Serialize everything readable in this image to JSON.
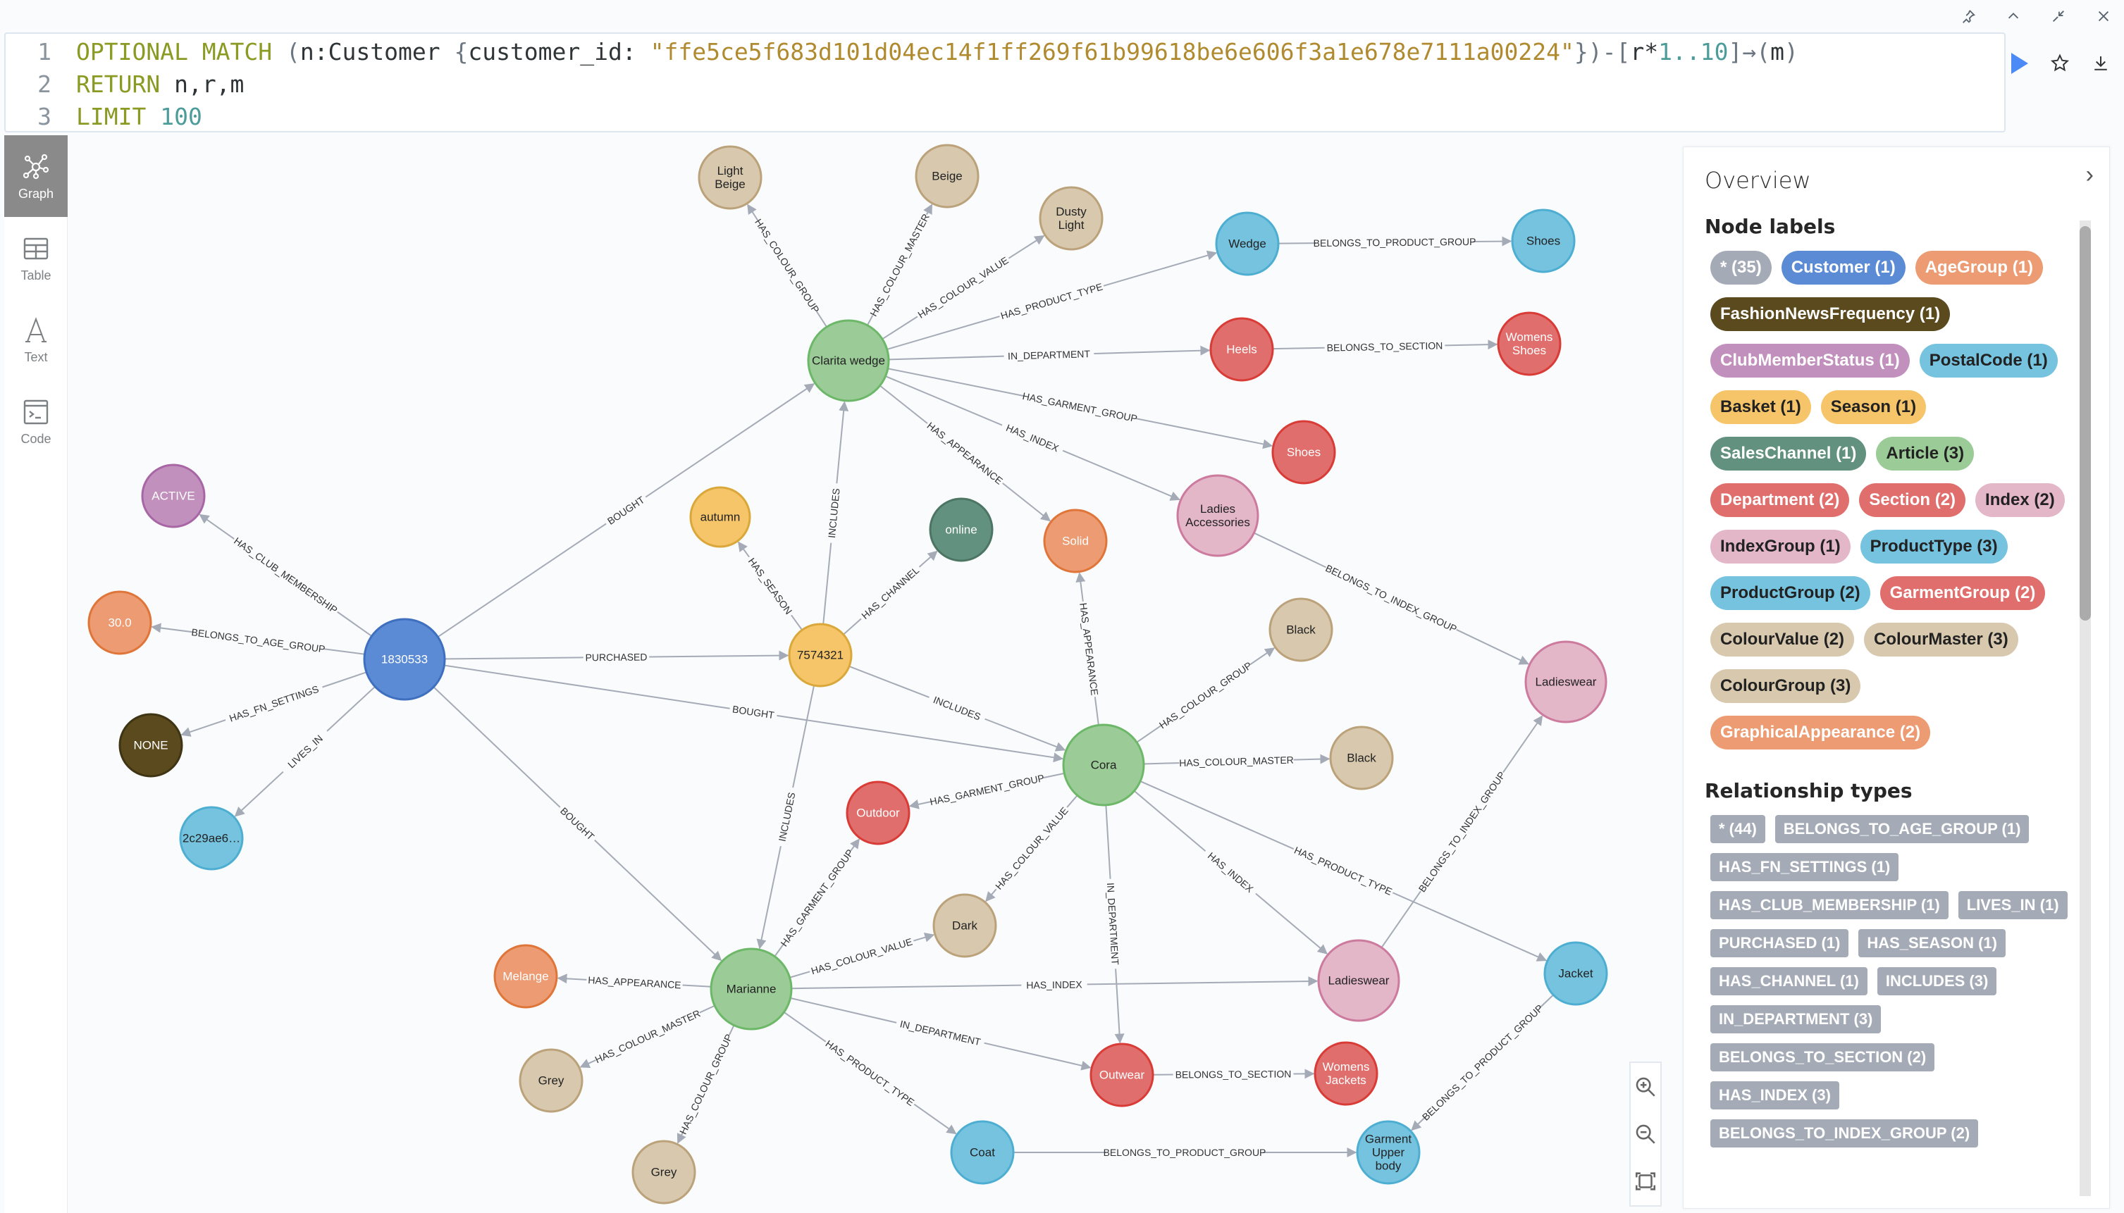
{
  "window_controls": [
    {
      "name": "pin-icon",
      "glyph": "⌖"
    },
    {
      "name": "collapse-up-icon",
      "glyph": "⌃"
    },
    {
      "name": "minimize-icon",
      "glyph": "↙"
    },
    {
      "name": "close-icon",
      "glyph": "✕"
    }
  ],
  "editor": {
    "line_numbers": [
      "1",
      "2",
      "3"
    ],
    "line1": {
      "kw": "OPTIONAL MATCH",
      "open": " (",
      "label": "n:Customer ",
      "brace_open": "{",
      "prop": "customer_id: ",
      "value": "\"ffe5ce5f683d101d04ec14f1ff269f61b99618be6e606f3a1e678e7111a00224\"",
      "brace_close": "})-[",
      "rel": "r*",
      "range": "1..10",
      "arrow": "]→(",
      "target": "m",
      "close": ")"
    },
    "line2": {
      "kw": "RETURN",
      "rest": " n,r,m"
    },
    "line3": {
      "kw": "LIMIT",
      "num": " 100"
    }
  },
  "editor_actions": {
    "run": "run-query",
    "favorite": "favorite",
    "download": "download"
  },
  "nav": [
    {
      "id": "graph",
      "label": "Graph",
      "active": true
    },
    {
      "id": "table",
      "label": "Table",
      "active": false
    },
    {
      "id": "text",
      "label": "Text",
      "active": false
    },
    {
      "id": "code",
      "label": "Code",
      "active": false
    }
  ],
  "colors": {
    "Customer": {
      "fill": "#5b8bd4",
      "stroke": "#3f6fbf",
      "text": "#ffffff"
    },
    "AgeGroup": {
      "fill": "#ec9b72",
      "stroke": "#e07539",
      "text": "#ffffff"
    },
    "FashionNewsFrequency": {
      "fill": "#5b4a1e",
      "stroke": "#3f3413",
      "text": "#ffffff"
    },
    "ClubMemberStatus": {
      "fill": "#c190bd",
      "stroke": "#a866a4",
      "text": "#ffffff"
    },
    "PostalCode": {
      "fill": "#75c3df",
      "stroke": "#4eaed2",
      "text": "#222222"
    },
    "Basket": {
      "fill": "#f6c569",
      "stroke": "#daa83a",
      "text": "#222222"
    },
    "Season": {
      "fill": "#f6c569",
      "stroke": "#daa83a",
      "text": "#222222"
    },
    "SalesChannel": {
      "fill": "#62927f",
      "stroke": "#4c7563",
      "text": "#ffffff"
    },
    "Article": {
      "fill": "#9bcb97",
      "stroke": "#6db868",
      "text": "#222222"
    },
    "Department": {
      "fill": "#e06e6c",
      "stroke": "#d93b36",
      "text": "#ffffff"
    },
    "Section": {
      "fill": "#e06e6c",
      "stroke": "#d93b36",
      "text": "#ffffff"
    },
    "Index": {
      "fill": "#e3b6c8",
      "stroke": "#cc7a9d",
      "text": "#222222"
    },
    "IndexGroup": {
      "fill": "#e3b6c8",
      "stroke": "#cc7a9d",
      "text": "#222222"
    },
    "ProductType": {
      "fill": "#75c3df",
      "stroke": "#4eaed2",
      "text": "#222222"
    },
    "ProductGroup": {
      "fill": "#75c3df",
      "stroke": "#4eaed2",
      "text": "#222222"
    },
    "GarmentGroup": {
      "fill": "#e06e6c",
      "stroke": "#d93b36",
      "text": "#ffffff"
    },
    "ColourValue": {
      "fill": "#d7c8ae",
      "stroke": "#bba27a",
      "text": "#222222"
    },
    "ColourMaster": {
      "fill": "#d7c8ae",
      "stroke": "#bba27a",
      "text": "#222222"
    },
    "ColourGroup": {
      "fill": "#d7c8ae",
      "stroke": "#bba27a",
      "text": "#222222"
    },
    "GraphicalAppearance": {
      "fill": "#ec9b72",
      "stroke": "#e07539",
      "text": "#ffffff"
    },
    "edge": "#a5abb6"
  },
  "graph": {
    "nodes": [
      {
        "id": "cust",
        "label": "Customer",
        "caption": [
          "1830533"
        ]
      },
      {
        "id": "active",
        "label": "ClubMemberStatus",
        "caption": [
          "ACTIVE"
        ]
      },
      {
        "id": "age",
        "label": "AgeGroup",
        "caption": [
          "30.0"
        ]
      },
      {
        "id": "none",
        "label": "FashionNewsFrequency",
        "caption": [
          "NONE"
        ]
      },
      {
        "id": "postal",
        "label": "PostalCode",
        "caption": [
          "2c29ae6…"
        ]
      },
      {
        "id": "basket",
        "label": "Basket",
        "caption": [
          "7574321"
        ]
      },
      {
        "id": "autumn",
        "label": "Season",
        "caption": [
          "autumn"
        ]
      },
      {
        "id": "online",
        "label": "SalesChannel",
        "caption": [
          "online"
        ]
      },
      {
        "id": "clarita",
        "label": "Article",
        "caption": [
          "Clarita wedge"
        ]
      },
      {
        "id": "cora",
        "label": "Article",
        "caption": [
          "Cora"
        ]
      },
      {
        "id": "marianne",
        "label": "Article",
        "caption": [
          "Marianne"
        ]
      },
      {
        "id": "lightbeige",
        "label": "ColourGroup",
        "caption": [
          "Light",
          "Beige"
        ]
      },
      {
        "id": "beige",
        "label": "ColourMaster",
        "caption": [
          "Beige"
        ]
      },
      {
        "id": "dustylight",
        "label": "ColourValue",
        "caption": [
          "Dusty",
          "Light"
        ]
      },
      {
        "id": "wedge",
        "label": "ProductType",
        "caption": [
          "Wedge"
        ]
      },
      {
        "id": "shoesPG",
        "label": "ProductGroup",
        "caption": [
          "Shoes"
        ]
      },
      {
        "id": "heels",
        "label": "Department",
        "caption": [
          "Heels"
        ]
      },
      {
        "id": "womensshoes",
        "label": "Section",
        "caption": [
          "Womens",
          "Shoes"
        ]
      },
      {
        "id": "shoesGG",
        "label": "GarmentGroup",
        "caption": [
          "Shoes"
        ]
      },
      {
        "id": "ladiesacc",
        "label": "Index",
        "caption": [
          "Ladies",
          "Accessories"
        ]
      },
      {
        "id": "solid",
        "label": "GraphicalAppearance",
        "caption": [
          "Solid"
        ]
      },
      {
        "id": "ladieswearIG",
        "label": "IndexGroup",
        "caption": [
          "Ladieswear"
        ]
      },
      {
        "id": "blackCG",
        "label": "ColourGroup",
        "caption": [
          "Black"
        ]
      },
      {
        "id": "blackCM",
        "label": "ColourMaster",
        "caption": [
          "Black"
        ]
      },
      {
        "id": "outdoor",
        "label": "GarmentGroup",
        "caption": [
          "Outdoor"
        ]
      },
      {
        "id": "dark",
        "label": "ColourValue",
        "caption": [
          "Dark"
        ]
      },
      {
        "id": "ladieswearI",
        "label": "Index",
        "caption": [
          "Ladieswear"
        ]
      },
      {
        "id": "jacket",
        "label": "ProductType",
        "caption": [
          "Jacket"
        ]
      },
      {
        "id": "melange",
        "label": "GraphicalAppearance",
        "caption": [
          "Melange"
        ]
      },
      {
        "id": "greyCM",
        "label": "ColourMaster",
        "caption": [
          "Grey"
        ]
      },
      {
        "id": "greyCG",
        "label": "ColourGroup",
        "caption": [
          "Grey"
        ]
      },
      {
        "id": "coat",
        "label": "ProductType",
        "caption": [
          "Coat"
        ]
      },
      {
        "id": "outwear",
        "label": "Department",
        "caption": [
          "Outwear"
        ]
      },
      {
        "id": "womensjackets",
        "label": "Section",
        "caption": [
          "Womens",
          "Jackets"
        ]
      },
      {
        "id": "garmentupper",
        "label": "ProductGroup",
        "caption": [
          "Garment",
          "Upper",
          "body"
        ]
      }
    ],
    "edges": [
      {
        "from": "cust",
        "to": "active",
        "type": "HAS_CLUB_MEMBERSHIP"
      },
      {
        "from": "cust",
        "to": "age",
        "type": "BELONGS_TO_AGE_GROUP"
      },
      {
        "from": "cust",
        "to": "none",
        "type": "HAS_FN_SETTINGS"
      },
      {
        "from": "cust",
        "to": "postal",
        "type": "LIVES_IN"
      },
      {
        "from": "cust",
        "to": "basket",
        "type": "PURCHASED"
      },
      {
        "from": "cust",
        "to": "clarita",
        "type": "BOUGHT"
      },
      {
        "from": "cust",
        "to": "cora",
        "type": "BOUGHT"
      },
      {
        "from": "cust",
        "to": "marianne",
        "type": "BOUGHT"
      },
      {
        "from": "basket",
        "to": "autumn",
        "type": "HAS_SEASON"
      },
      {
        "from": "basket",
        "to": "online",
        "type": "HAS_CHANNEL"
      },
      {
        "from": "basket",
        "to": "clarita",
        "type": "INCLUDES"
      },
      {
        "from": "basket",
        "to": "cora",
        "type": "INCLUDES"
      },
      {
        "from": "basket",
        "to": "marianne",
        "type": "INCLUDES"
      },
      {
        "from": "clarita",
        "to": "lightbeige",
        "type": "HAS_COLOUR_GROUP"
      },
      {
        "from": "clarita",
        "to": "beige",
        "type": "HAS_COLOUR_MASTER"
      },
      {
        "from": "clarita",
        "to": "dustylight",
        "type": "HAS_COLOUR_VALUE"
      },
      {
        "from": "clarita",
        "to": "wedge",
        "type": "HAS_PRODUCT_TYPE"
      },
      {
        "from": "clarita",
        "to": "heels",
        "type": "IN_DEPARTMENT"
      },
      {
        "from": "clarita",
        "to": "shoesGG",
        "type": "HAS_GARMENT_GROUP"
      },
      {
        "from": "clarita",
        "to": "ladiesacc",
        "type": "HAS_INDEX"
      },
      {
        "from": "clarita",
        "to": "solid",
        "type": "HAS_APPEARANCE"
      },
      {
        "from": "wedge",
        "to": "shoesPG",
        "type": "BELONGS_TO_PRODUCT_GROUP"
      },
      {
        "from": "heels",
        "to": "womensshoes",
        "type": "BELONGS_TO_SECTION"
      },
      {
        "from": "ladiesacc",
        "to": "ladieswearIG",
        "type": "BELONGS_TO_INDEX_GROUP"
      },
      {
        "from": "cora",
        "to": "solid",
        "type": "HAS_APPEARANCE"
      },
      {
        "from": "cora",
        "to": "blackCG",
        "type": "HAS_COLOUR_GROUP"
      },
      {
        "from": "cora",
        "to": "blackCM",
        "type": "HAS_COLOUR_MASTER"
      },
      {
        "from": "cora",
        "to": "outdoor",
        "type": "HAS_GARMENT_GROUP"
      },
      {
        "from": "cora",
        "to": "dark",
        "type": "HAS_COLOUR_VALUE"
      },
      {
        "from": "cora",
        "to": "outwear",
        "type": "IN_DEPARTMENT"
      },
      {
        "from": "cora",
        "to": "ladieswearI",
        "type": "HAS_INDEX"
      },
      {
        "from": "cora",
        "to": "jacket",
        "type": "HAS_PRODUCT_TYPE"
      },
      {
        "from": "ladieswearI",
        "to": "ladieswearIG",
        "type": "BELONGS_TO_INDEX_GROUP"
      },
      {
        "from": "jacket",
        "to": "garmentupper",
        "type": "BELONGS_TO_PRODUCT_GROUP"
      },
      {
        "from": "marianne",
        "to": "melange",
        "type": "HAS_APPEARANCE"
      },
      {
        "from": "marianne",
        "to": "greyCM",
        "type": "HAS_COLOUR_MASTER"
      },
      {
        "from": "marianne",
        "to": "greyCG",
        "type": "HAS_COLOUR_GROUP"
      },
      {
        "from": "marianne",
        "to": "outdoor",
        "type": "HAS_GARMENT_GROUP"
      },
      {
        "from": "marianne",
        "to": "dark",
        "type": "HAS_COLOUR_VALUE"
      },
      {
        "from": "marianne",
        "to": "ladieswearI",
        "type": "HAS_INDEX"
      },
      {
        "from": "marianne",
        "to": "outwear",
        "type": "IN_DEPARTMENT"
      },
      {
        "from": "marianne",
        "to": "coat",
        "type": "HAS_PRODUCT_TYPE"
      },
      {
        "from": "outwear",
        "to": "womensjackets",
        "type": "BELONGS_TO_SECTION"
      },
      {
        "from": "coat",
        "to": "garmentupper",
        "type": "BELONGS_TO_PRODUCT_GROUP"
      }
    ]
  },
  "overview": {
    "title": "Overview",
    "node_labels_title": "Node labels",
    "node_labels": [
      {
        "label": "* (35)",
        "key": "all",
        "bg": "#a5abb6",
        "fg": "#ffffff"
      },
      {
        "label": "Customer (1)",
        "key": "Customer"
      },
      {
        "label": "AgeGroup (1)",
        "key": "AgeGroup"
      },
      {
        "label": "FashionNewsFrequency (1)",
        "key": "FashionNewsFrequency"
      },
      {
        "label": "ClubMemberStatus (1)",
        "key": "ClubMemberStatus"
      },
      {
        "label": "PostalCode (1)",
        "key": "PostalCode"
      },
      {
        "label": "Basket (1)",
        "key": "Basket"
      },
      {
        "label": "Season (1)",
        "key": "Season"
      },
      {
        "label": "SalesChannel (1)",
        "key": "SalesChannel"
      },
      {
        "label": "Article (3)",
        "key": "Article"
      },
      {
        "label": "Department (2)",
        "key": "Department"
      },
      {
        "label": "Section (2)",
        "key": "Section"
      },
      {
        "label": "Index (2)",
        "key": "Index"
      },
      {
        "label": "IndexGroup (1)",
        "key": "IndexGroup"
      },
      {
        "label": "ProductType (3)",
        "key": "ProductType"
      },
      {
        "label": "ProductGroup (2)",
        "key": "ProductGroup"
      },
      {
        "label": "GarmentGroup (2)",
        "key": "GarmentGroup"
      },
      {
        "label": "ColourValue (2)",
        "key": "ColourValue"
      },
      {
        "label": "ColourMaster (3)",
        "key": "ColourMaster"
      },
      {
        "label": "ColourGroup (3)",
        "key": "ColourGroup"
      },
      {
        "label": "GraphicalAppearance (2)",
        "key": "GraphicalAppearance"
      }
    ],
    "relationship_types_title": "Relationship types",
    "relationship_types": [
      "* (44)",
      "BELONGS_TO_AGE_GROUP (1)",
      "HAS_FN_SETTINGS (1)",
      "HAS_CLUB_MEMBERSHIP (1)",
      "LIVES_IN (1)",
      "PURCHASED (1)",
      "HAS_SEASON (1)",
      "HAS_CHANNEL (1)",
      "INCLUDES (3)",
      "IN_DEPARTMENT (3)",
      "BELONGS_TO_SECTION (2)",
      "HAS_INDEX (3)",
      "BELONGS_TO_INDEX_GROUP (2)"
    ]
  }
}
